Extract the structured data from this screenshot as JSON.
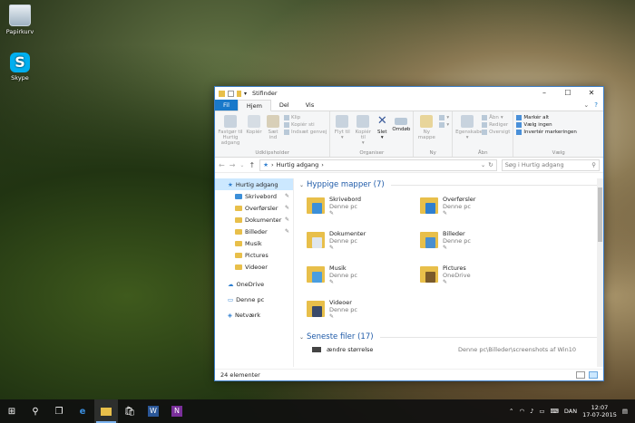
{
  "desktop": {
    "icons": [
      {
        "label": "Papirkurv",
        "icon": "recycle-bin-icon"
      },
      {
        "label": "Skype",
        "icon": "skype-icon",
        "glyph": "S"
      }
    ]
  },
  "window": {
    "title": "Stifinder",
    "tabs": [
      "Fil",
      "Hjem",
      "Del",
      "Vis"
    ],
    "ribbon": {
      "udklipsholder": {
        "group_label": "Udklipsholder",
        "pin": "Fastgør til Hurtig adgang",
        "copy": "Kopiér",
        "paste": "Sæt ind",
        "cut": "Klip",
        "copy_path": "Kopiér sti",
        "paste_shortcut": "Indsæt genvej"
      },
      "organiser": {
        "group_label": "Organiser",
        "move": "Flyt til",
        "copy_to": "Kopiér til",
        "delete": "Slet",
        "rename": "Omdøb"
      },
      "ny": {
        "group_label": "Ny",
        "new_folder": "Ny mappe"
      },
      "aabn": {
        "group_label": "Åbn",
        "properties": "Egenskaber",
        "open": "Åbn",
        "edit": "Rediger",
        "history": "Oversigt"
      },
      "vaelg": {
        "group_label": "Vælg",
        "select_all": "Markér alt",
        "select_none": "Vælg ingen",
        "invert": "Invertér markeringen"
      }
    },
    "address": {
      "path": "Hurtig adgang",
      "search_placeholder": "Søg i Hurtig adgang"
    },
    "nav_pane": {
      "quick_access": "Hurtig adgang",
      "quick_items": [
        "Skrivebord",
        "Overførsler",
        "Dokumenter",
        "Billeder",
        "Musik",
        "Pictures",
        "Videoer"
      ],
      "onedrive": "OneDrive",
      "this_pc": "Denne pc",
      "network": "Netværk"
    },
    "frequent": {
      "header": "Hyppige mapper (7)",
      "folders": [
        {
          "name": "Skrivebord",
          "location": "Denne pc",
          "overlay": "#3c8fd8"
        },
        {
          "name": "Overførsler",
          "location": "Denne pc",
          "overlay": "#2f7fd0"
        },
        {
          "name": "Dokumenter",
          "location": "Denne pc",
          "overlay": "#dfe6ee"
        },
        {
          "name": "Billeder",
          "location": "Denne pc",
          "overlay": "#4a8fcf"
        },
        {
          "name": "Musik",
          "location": "Denne pc",
          "overlay": "#4a9ee0"
        },
        {
          "name": "Pictures",
          "location": "OneDrive",
          "overlay": "#7a5a2a"
        },
        {
          "name": "Videoer",
          "location": "Denne pc",
          "overlay": "#3a4a6a"
        }
      ]
    },
    "recent": {
      "header": "Seneste filer (17)",
      "items": [
        {
          "name": "ændre størrelse",
          "path": "Denne pc\\Billeder\\screenshots af Win10"
        }
      ]
    },
    "status": "24 elementer",
    "accent_color": "#1979ca"
  },
  "taskbar": {
    "language": "DAN",
    "time": "12:07",
    "date": "17-07-2015"
  }
}
